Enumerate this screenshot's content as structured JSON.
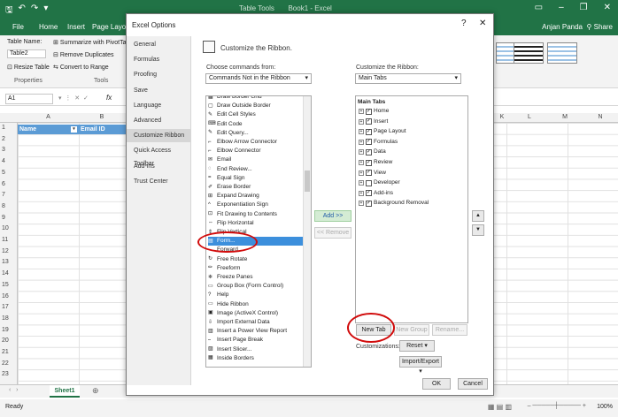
{
  "excel": {
    "window_title": "Book1 - Excel",
    "context_tab": "Table Tools",
    "tabs": [
      "File",
      "Home",
      "Insert",
      "Page Layout"
    ],
    "user": "Anjan Panda",
    "share": "Share",
    "ribbon": {
      "table_name_label": "Table Name:",
      "table_name_value": "Table2",
      "resize_table": "Resize Table",
      "summarize_pivot": "Summarize with PivotTable",
      "remove_duplicates": "Remove Duplicates",
      "convert_to_range": "Convert to Range",
      "group_properties": "Properties",
      "group_tools": "Tools"
    },
    "name_box": "A1",
    "formula_symbol": "fx",
    "columns": [
      "A",
      "B",
      "K",
      "L",
      "M",
      "N"
    ],
    "rows": [
      "1",
      "2",
      "3",
      "4",
      "5",
      "6",
      "7",
      "8",
      "9",
      "10",
      "11",
      "12",
      "13",
      "14",
      "15",
      "16",
      "17",
      "18",
      "19",
      "20",
      "21",
      "22",
      "23"
    ],
    "cells": {
      "A1": "Name",
      "B1": "Email ID"
    },
    "sheet": "Sheet1",
    "status": "Ready",
    "zoom": "100%"
  },
  "dialog": {
    "title": "Excel Options",
    "help": "?",
    "close": "✕",
    "nav": [
      "General",
      "Formulas",
      "Proofing",
      "Save",
      "Language",
      "Advanced",
      "Customize Ribbon",
      "Quick Access Toolbar",
      "Add-ins",
      "Trust Center"
    ],
    "selected_nav": "Customize Ribbon",
    "heading": "Customize the Ribbon.",
    "choose_label": "Choose commands from:",
    "choose_value": "Commands Not in the Ribbon",
    "customize_label": "Customize the Ribbon:",
    "customize_value": "Main Tabs",
    "commands": [
      "Draw Border Grid",
      "Draw Outside Border",
      "Edit Cell Styles",
      "Edit Code",
      "Edit Query...",
      "Elbow Arrow Connector",
      "Elbow Connector",
      "Email",
      "End Review...",
      "Equal Sign",
      "Erase Border",
      "Expand Drawing",
      "Exponentiation Sign",
      "Fit Drawing to Contents",
      "Flip Horizontal",
      "Flip Vertical",
      "Form...",
      "Forward",
      "Free Rotate",
      "Freeform",
      "Freeze Panes",
      "Group Box (Form Control)",
      "Help",
      "Hide Ribbon",
      "Image (ActiveX Control)",
      "Import External Data",
      "Insert a Power View Report",
      "Insert Page Break",
      "Insert Slicer...",
      "Inside Borders"
    ],
    "selected_command": "Form...",
    "add_button": "Add >>",
    "remove_button": "<< Remove",
    "tree_header": "Main Tabs",
    "tree": [
      "Home",
      "Insert",
      "Page Layout",
      "Formulas",
      "Data",
      "Review",
      "View",
      "Developer",
      "Add-ins",
      "Background Removal"
    ],
    "tree_checked": [
      true,
      true,
      true,
      true,
      true,
      true,
      true,
      false,
      true,
      true
    ],
    "new_tab": "New Tab",
    "new_group": "New Group",
    "rename": "Rename...",
    "customizations_label": "Customizations:",
    "reset": "Reset",
    "import_export": "Import/Export",
    "ok": "OK",
    "cancel": "Cancel"
  },
  "colors": {
    "excel_green": "#217346",
    "header_blue": "#5b9bd5",
    "highlight": "#3c8fdc",
    "annotation_red": "#d10b0b"
  }
}
